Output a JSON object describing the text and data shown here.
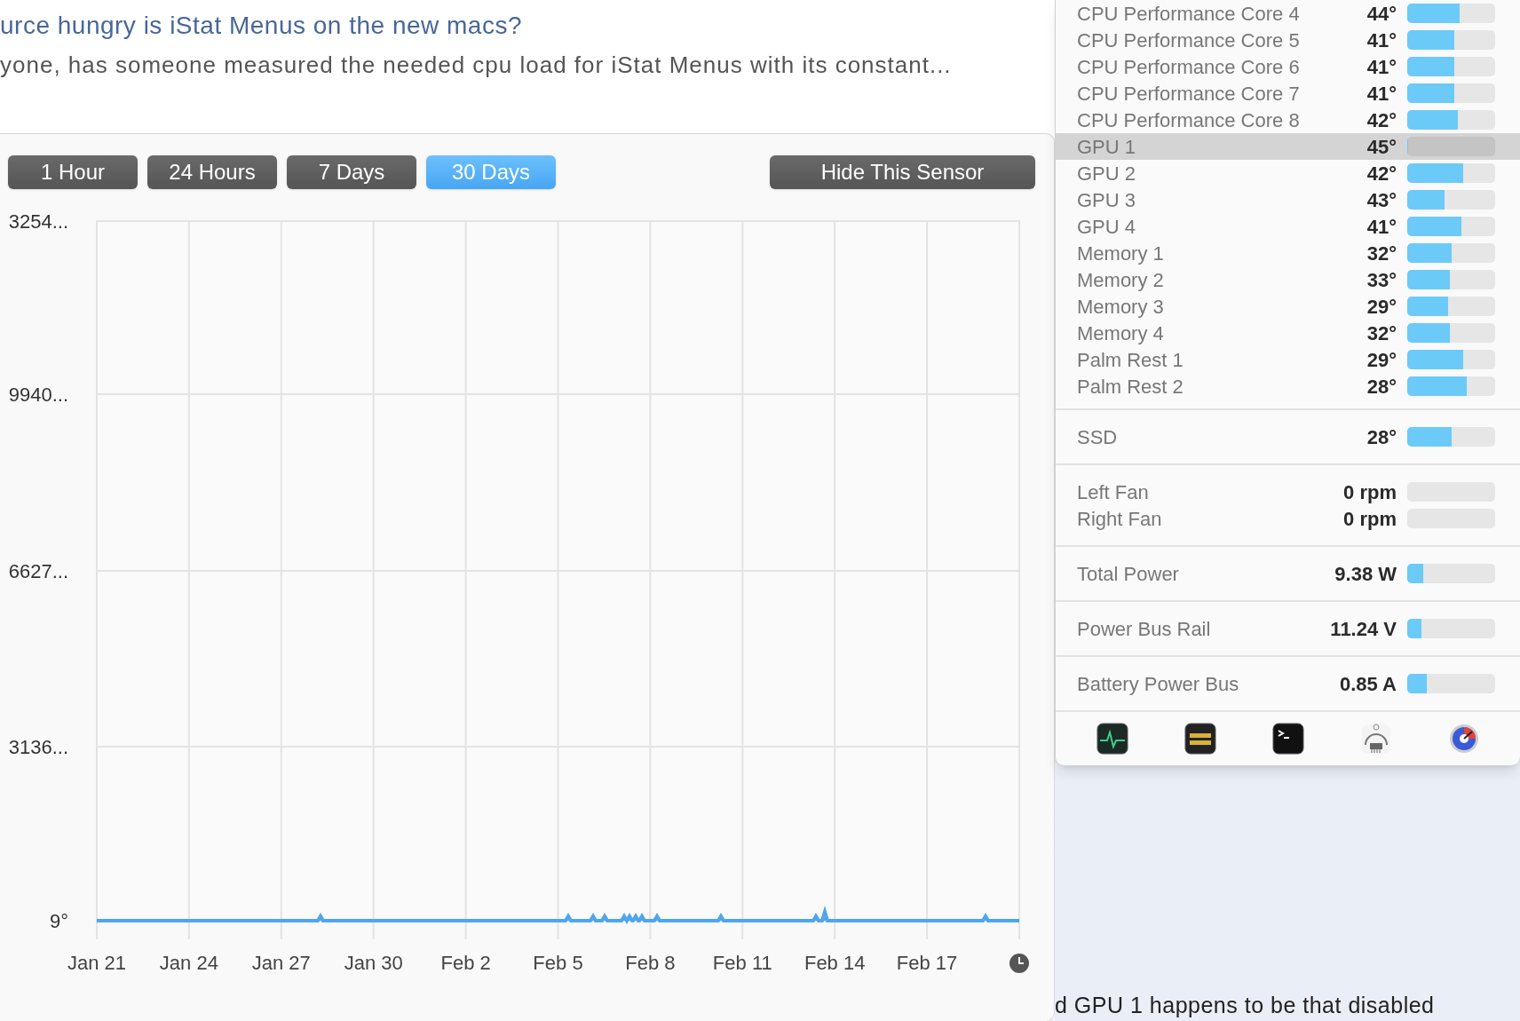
{
  "page": {
    "title": "urce hungry is iStat Menus on the new macs?",
    "snippet": "yone, has someone measured the needed cpu load for iStat Menus with its constant...",
    "footer_text": "d GPU 1 happens to be that disabled"
  },
  "history_window": {
    "ranges": [
      {
        "label": "1 Hour",
        "selected": false
      },
      {
        "label": "24 Hours",
        "selected": false
      },
      {
        "label": "7 Days",
        "selected": false
      },
      {
        "label": "30 Days",
        "selected": true
      }
    ],
    "hide_button": "Hide This Sensor",
    "y_axis_labels": [
      "3254...",
      "9940...",
      "6627...",
      "3136...",
      "9°"
    ],
    "x_axis_labels": [
      "Jan 21",
      "Jan 24",
      "Jan 27",
      "Jan 30",
      "Feb 2",
      "Feb 5",
      "Feb 8",
      "Feb 11",
      "Feb 14",
      "Feb 17"
    ]
  },
  "sensor_menu": {
    "sections": [
      {
        "rows": [
          {
            "name": "CPU Performance Core 4",
            "value": "44°",
            "level": 0.6,
            "selected": false
          },
          {
            "name": "CPU Performance Core 5",
            "value": "41°",
            "level": 0.54,
            "selected": false
          },
          {
            "name": "CPU Performance Core 6",
            "value": "41°",
            "level": 0.54,
            "selected": false
          },
          {
            "name": "CPU Performance Core 7",
            "value": "41°",
            "level": 0.54,
            "selected": false
          },
          {
            "name": "CPU Performance Core 8",
            "value": "42°",
            "level": 0.58,
            "selected": false
          },
          {
            "name": "GPU 1",
            "value": "45°",
            "level": 0.01,
            "selected": true
          },
          {
            "name": "GPU 2",
            "value": "42°",
            "level": 0.64,
            "selected": false
          },
          {
            "name": "GPU 3",
            "value": "43°",
            "level": 0.42,
            "selected": false
          },
          {
            "name": "GPU 4",
            "value": "41°",
            "level": 0.62,
            "selected": false
          },
          {
            "name": "Memory 1",
            "value": "32°",
            "level": 0.5,
            "selected": false
          },
          {
            "name": "Memory 2",
            "value": "33°",
            "level": 0.48,
            "selected": false
          },
          {
            "name": "Memory 3",
            "value": "29°",
            "level": 0.46,
            "selected": false
          },
          {
            "name": "Memory 4",
            "value": "32°",
            "level": 0.48,
            "selected": false
          },
          {
            "name": "Palm Rest 1",
            "value": "29°",
            "level": 0.64,
            "selected": false
          },
          {
            "name": "Palm Rest 2",
            "value": "28°",
            "level": 0.68,
            "selected": false
          }
        ]
      },
      {
        "rows": [
          {
            "name": "SSD",
            "value": "28°",
            "level": 0.5,
            "selected": false
          }
        ]
      },
      {
        "rows": [
          {
            "name": "Left Fan",
            "value": "0 rpm",
            "selected": false
          },
          {
            "name": "Right Fan",
            "value": "0 rpm",
            "selected": false
          }
        ]
      },
      {
        "rows": [
          {
            "name": "Total Power",
            "value": "9.38 W",
            "level": 0.18,
            "selected": false
          }
        ]
      },
      {
        "rows": [
          {
            "name": "Power Bus Rail",
            "value": "11.24 V",
            "level": 0.16,
            "selected": false
          }
        ]
      },
      {
        "rows": [
          {
            "name": "Battery Power Bus",
            "value": "0.85 A",
            "level": 0.22,
            "selected": false
          }
        ]
      }
    ]
  }
}
